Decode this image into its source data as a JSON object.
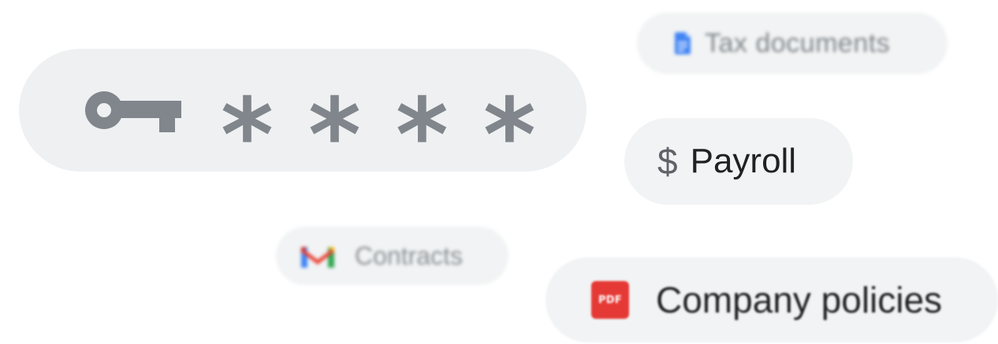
{
  "password": {
    "masked_chars": [
      "*",
      "*",
      "*",
      "*"
    ],
    "icon": "key-icon"
  },
  "tags": {
    "tax_documents": {
      "label": "Tax documents",
      "icon": "google-docs-icon",
      "icon_color": "#4285f4"
    },
    "payroll": {
      "label": "Payroll",
      "icon_glyph": "$",
      "icon": "dollar-icon"
    },
    "contracts": {
      "label": "Contracts",
      "icon": "gmail-icon"
    },
    "company_policies": {
      "label": "Company policies",
      "icon_text": "PDF",
      "icon": "pdf-icon",
      "icon_color": "#e53935"
    }
  },
  "colors": {
    "pill_background": "#f1f3f4",
    "muted_gray": "#80868b",
    "text_dark": "#202124"
  }
}
